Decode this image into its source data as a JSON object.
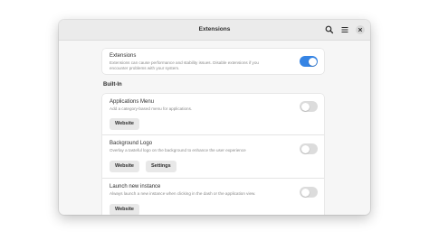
{
  "window": {
    "title": "Extensions"
  },
  "header": {
    "search_icon": "search-icon",
    "menu_icon": "hamburger-menu-icon",
    "close_icon": "close-icon"
  },
  "global": {
    "title": "Extensions",
    "description_line1": "Extensions can cause performance and stability issues. Disable extensions if you",
    "description_line2": "encounter problems with your system.",
    "enabled": true
  },
  "section": {
    "label": "Built-In"
  },
  "extensions": [
    {
      "name": "Applications Menu",
      "description": "Add a category-based menu for applications.",
      "website_label": "Website",
      "enabled": false
    },
    {
      "name": "Background Logo",
      "description": "Overlay a tasteful logo on the background to enhance the user experience",
      "website_label": "Website",
      "settings_label": "Settings",
      "enabled": false
    },
    {
      "name": "Launch new instance",
      "description": "Always launch a new instance when clicking in the dash or the application view.",
      "website_label": "Website",
      "enabled": false
    }
  ],
  "colors": {
    "accent": "#3584e4",
    "toggle_off": "#dcdcdc"
  }
}
